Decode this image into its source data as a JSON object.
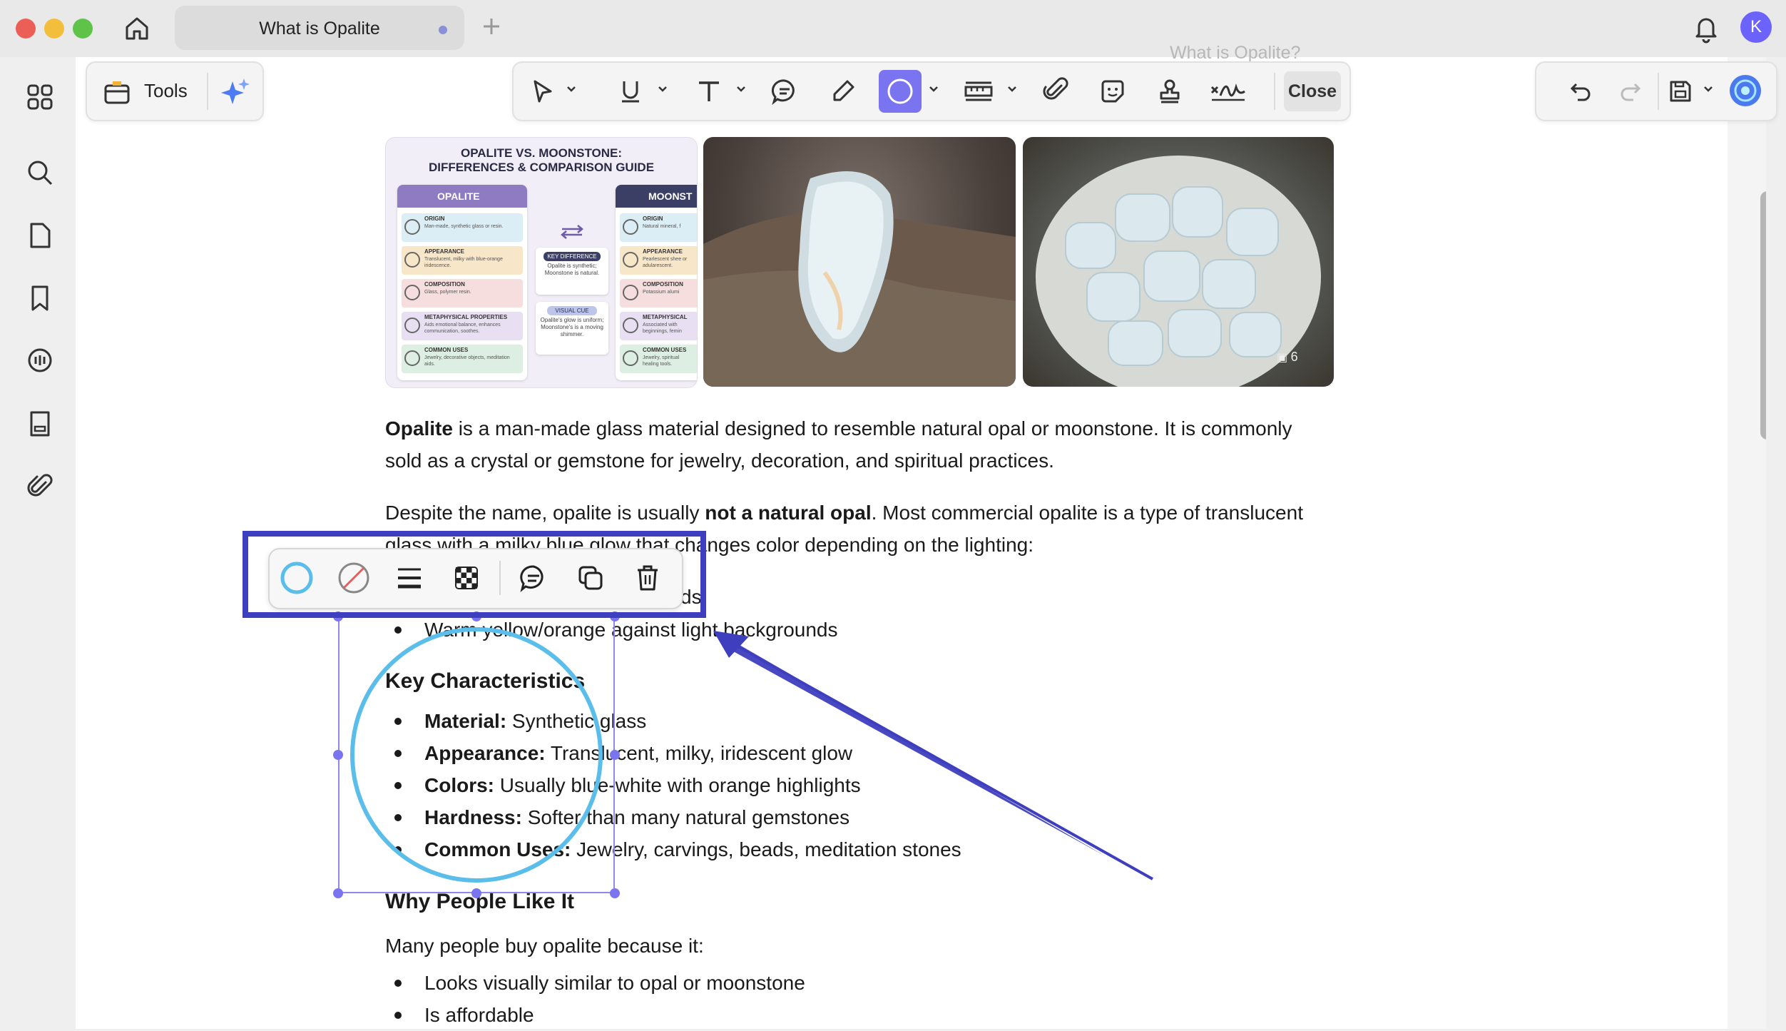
{
  "window": {
    "tab_title": "What is Opalite",
    "avatar_initial": "K"
  },
  "toolbar": {
    "tools_label": "Tools",
    "close_label": "Close",
    "faded_title": "What is Opalite?"
  },
  "images": {
    "infographic": {
      "title_line1": "OPALITE VS. MOONSTONE:",
      "title_line2": "DIFFERENCES & COMPARISON GUIDE",
      "left_header": "OPALITE",
      "right_header": "MOONST",
      "left_rows": [
        {
          "title": "ORIGIN",
          "text": "Man-made, synthetic glass or resin."
        },
        {
          "title": "APPEARANCE",
          "text": "Translucent, milky with blue-orange iridescence."
        },
        {
          "title": "COMPOSITION",
          "text": "Glass, polymer resin."
        },
        {
          "title": "METAPHYSICAL PROPERTIES",
          "text": "Aids emotional balance, enhances communication, soothes."
        },
        {
          "title": "COMMON USES",
          "text": "Jewelry, decorative objects, meditation aids."
        }
      ],
      "right_rows": [
        {
          "title": "ORIGIN",
          "text": "Natural mineral, f"
        },
        {
          "title": "APPEARANCE",
          "text": "Pearlescent shee or adularescent."
        },
        {
          "title": "COMPOSITION",
          "text": "Potassium alumi"
        },
        {
          "title": "METAPHYSICAL",
          "text": "Associated with beginnings, femin"
        },
        {
          "title": "COMMON USES",
          "text": "Jewelry, spiritual healing tools."
        }
      ],
      "key_difference": "KEY DIFFERENCE",
      "key_difference_text": "Opalite is synthetic; Moonstone is natural.",
      "visual_cue": "VISUAL CUE",
      "visual_cue_text": "Opalite's glow is uniform; Moonstone's is a moving shimmer."
    },
    "photo_badge": "6"
  },
  "content": {
    "p1_bold": "Opalite",
    "p1_rest": " is a man-made glass material designed to resemble natural opal or moonstone. It is commonly",
    "p1_line2": "sold as a crystal or gemstone for jewelry, decoration, and spiritual practices.",
    "p2_a": "Despite the name, opalite is usually ",
    "p2_bold": "not a natural opal",
    "p2_b": ". Most commercial opalite is a type of translucent",
    "p2_line2": "glass with a milky blue glow that changes color depending on the lighting:",
    "partial_bullet_tail": "ds",
    "bullet_warm": "Warm yellow/orange against light backgrounds",
    "heading_key": "Key Characteristics",
    "characteristics": [
      {
        "label": "Material:",
        "text": " Synthetic glass"
      },
      {
        "label": "Appearance:",
        "text": " Translucent, milky, iridescent glow"
      },
      {
        "label": "Colors:",
        "text": " Usually blue-white with orange highlights"
      },
      {
        "label": "Hardness:",
        "text": " Softer than many natural gemstones"
      },
      {
        "label": "Common Uses:",
        "text": " Jewelry, carvings, beads, meditation stones"
      }
    ],
    "heading_why": "Why People Like It",
    "why_intro": "Many people buy opalite because it:",
    "why_items": [
      "Looks visually similar to opal or moonstone",
      "Is affordable"
    ]
  },
  "colors": {
    "accent": "#6c63ff",
    "highlight_box": "#3e3fbf",
    "circle_annotation": "#5bbdea",
    "selection_handles": "#7b74f0"
  }
}
